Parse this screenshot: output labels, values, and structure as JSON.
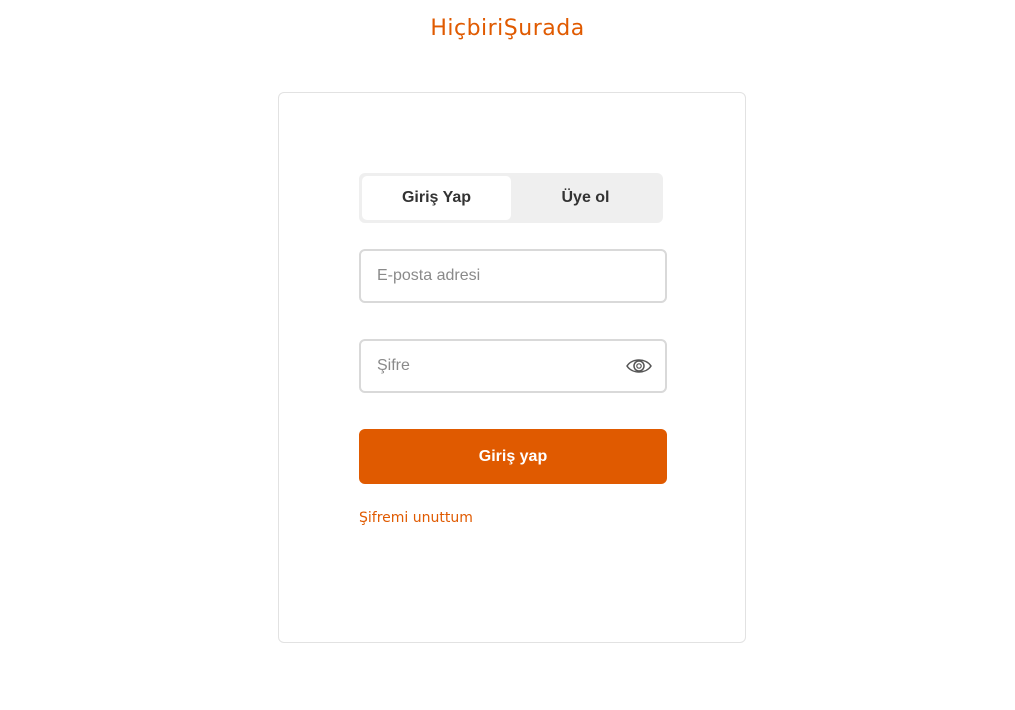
{
  "brand": {
    "name": "HiçbiriŞurada"
  },
  "auth_tabs": {
    "login_label": "Giriş Yap",
    "signup_label": "Üye ol",
    "active": "login"
  },
  "form": {
    "email": {
      "value": "",
      "placeholder": "E-posta adresi"
    },
    "password": {
      "value": "",
      "placeholder": "Şifre",
      "toggle_icon": "eye-icon"
    },
    "submit_label": "Giriş yap",
    "forgot_label": "Şifremi unuttum"
  },
  "colors": {
    "accent": "#e05a00",
    "tab_background": "#efefef",
    "border": "#d9d9d9"
  }
}
